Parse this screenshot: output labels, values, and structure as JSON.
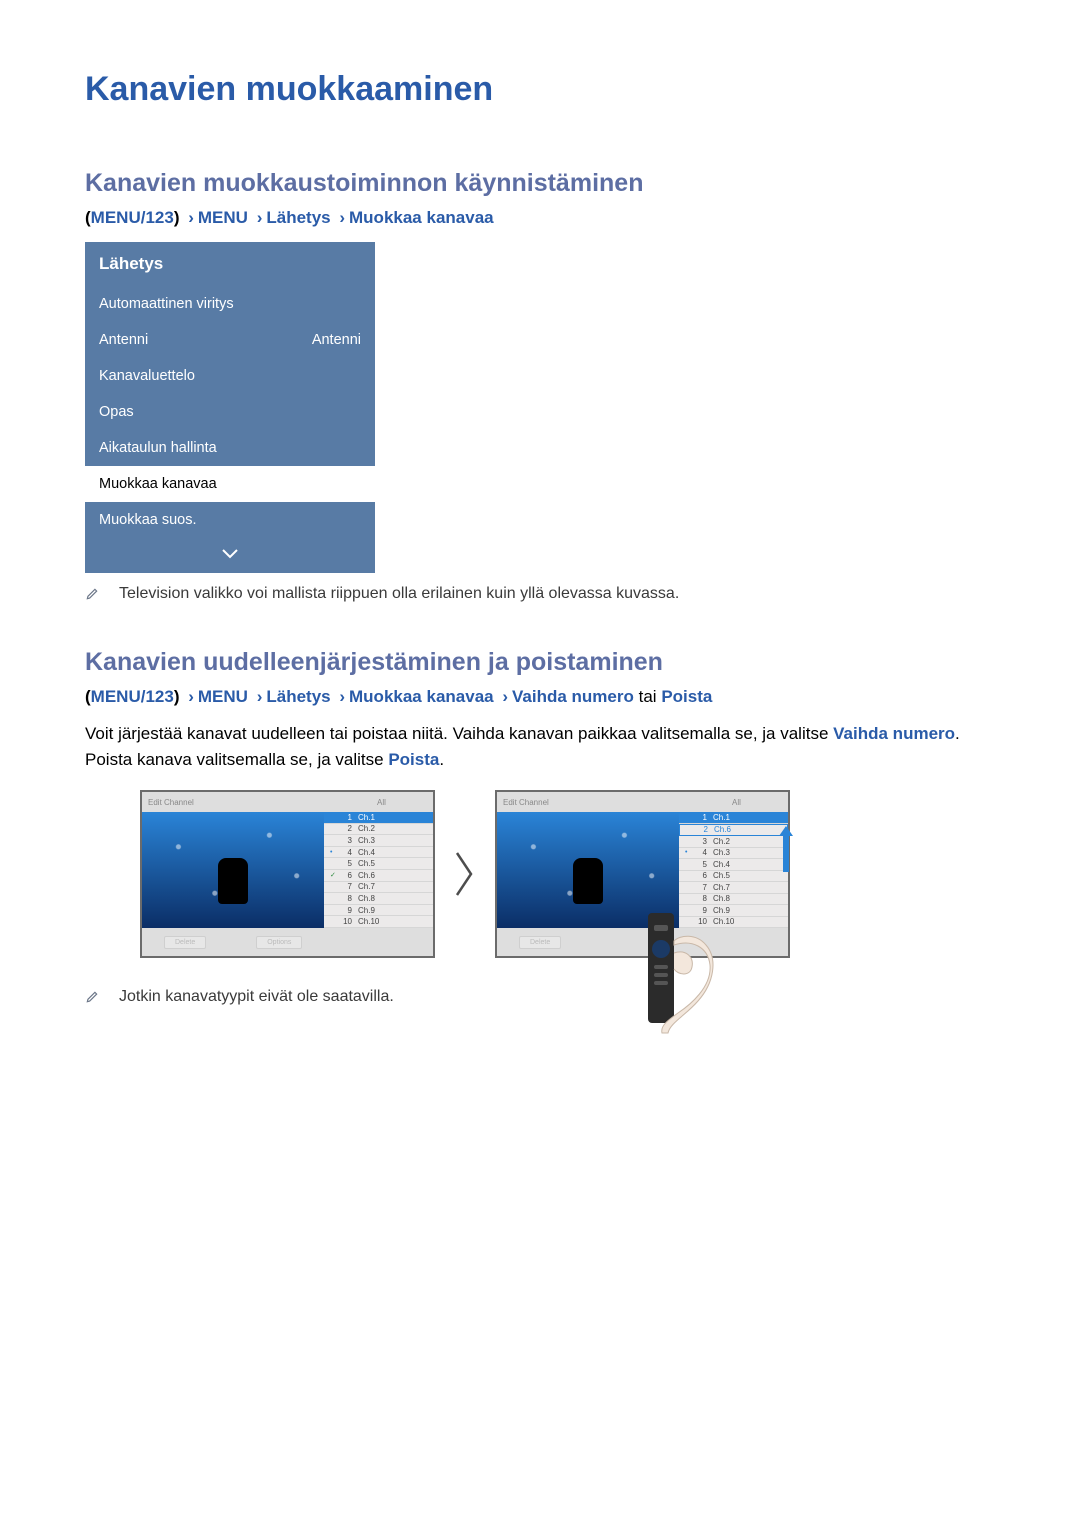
{
  "title": "Kanavien muokkaaminen",
  "section1": {
    "heading": "Kanavien muokkaustoiminnon käynnistäminen",
    "path": {
      "key": "MENU/123",
      "a": "MENU",
      "b": "Lähetys",
      "c": "Muokkaa kanavaa"
    },
    "menu": {
      "header": "Lähetys",
      "items": [
        {
          "label": "Automaattinen viritys",
          "value": ""
        },
        {
          "label": "Antenni",
          "value": "Antenni"
        },
        {
          "label": "Kanavaluettelo",
          "value": ""
        },
        {
          "label": "Opas",
          "value": ""
        },
        {
          "label": "Aikataulun hallinta",
          "value": ""
        },
        {
          "label": "Muokkaa kanavaa",
          "value": "",
          "selected": true
        },
        {
          "label": "Muokkaa suos.",
          "value": ""
        }
      ]
    },
    "note": "Television valikko voi mallista riippuen olla erilainen kuin yllä olevassa kuvassa."
  },
  "section2": {
    "heading": "Kanavien uudelleenjärjestäminen ja poistaminen",
    "path": {
      "key": "MENU/123",
      "a": "MENU",
      "b": "Lähetys",
      "c": "Muokkaa kanavaa",
      "d": "Vaihda numero",
      "plain": "tai",
      "e": "Poista"
    },
    "body": {
      "t1": "Voit järjestää kanavat uudelleen tai poistaa niitä. Vaihda kanavan paikkaa valitsemalla se, ja valitse ",
      "k1": "Vaihda numero",
      "t2": ". Poista kanava valitsemalla se, ja valitse ",
      "k2": "Poista",
      "t3": "."
    },
    "shot_title": "Edit Channel",
    "shot_tab": "All",
    "left_channels": [
      {
        "n": "1",
        "name": "Ch.1",
        "sel": true
      },
      {
        "n": "2",
        "name": "Ch.2"
      },
      {
        "n": "3",
        "name": "Ch.3"
      },
      {
        "n": "4",
        "name": "Ch.4",
        "mark": "•"
      },
      {
        "n": "5",
        "name": "Ch.5"
      },
      {
        "n": "6",
        "name": "Ch.6",
        "mark": "✓",
        "green": true
      },
      {
        "n": "7",
        "name": "Ch.7"
      },
      {
        "n": "8",
        "name": "Ch.8"
      },
      {
        "n": "9",
        "name": "Ch.9"
      },
      {
        "n": "10",
        "name": "Ch.10"
      }
    ],
    "right_channels": [
      {
        "n": "1",
        "name": "Ch.1",
        "sel": true
      },
      {
        "n": "2",
        "name": "Ch.6",
        "sel2": true
      },
      {
        "n": "3",
        "name": "Ch.2"
      },
      {
        "n": "4",
        "name": "Ch.3",
        "mark": "•"
      },
      {
        "n": "5",
        "name": "Ch.4"
      },
      {
        "n": "6",
        "name": "Ch.5"
      },
      {
        "n": "7",
        "name": "Ch.7"
      },
      {
        "n": "8",
        "name": "Ch.8"
      },
      {
        "n": "9",
        "name": "Ch.9"
      },
      {
        "n": "10",
        "name": "Ch.10"
      }
    ],
    "btn_delete": "Delete",
    "btn_options": "Options",
    "note": "Jotkin kanavatyypit eivät ole saatavilla."
  }
}
